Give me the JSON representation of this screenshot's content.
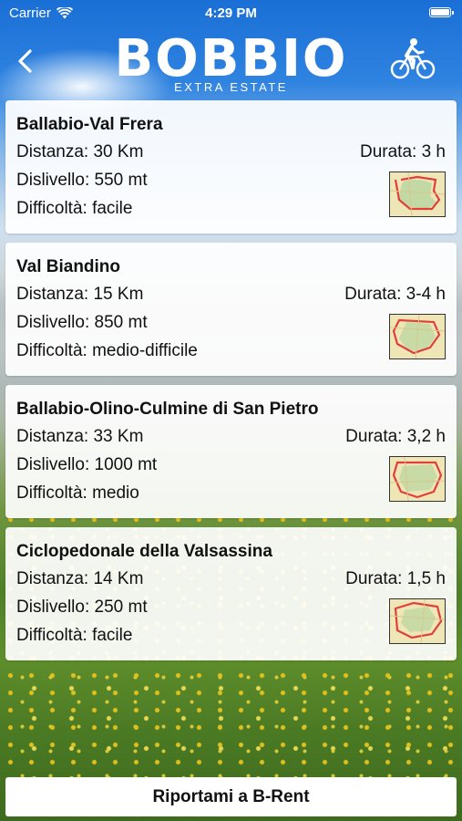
{
  "status": {
    "carrier": "Carrier",
    "time": "4:29 PM",
    "battery_level": 1.0
  },
  "header": {
    "logo_title": "BOBBIO",
    "logo_subtitle": "EXTRA ESTATE",
    "back_icon": "chevron-left-icon",
    "bike_icon": "cyclist-icon"
  },
  "routes": [
    {
      "title": "Ballabio-Val Frera",
      "distance": "Distanza: 30 Km",
      "duration": "Durata: 3 h",
      "elevation": "Dislivello: 550 mt",
      "difficulty": "Difficoltà: facile"
    },
    {
      "title": "Val Biandino",
      "distance": "Distanza: 15 Km",
      "duration": "Durata: 3-4 h",
      "elevation": "Dislivello: 850 mt",
      "difficulty": "Difficoltà: medio-difficile"
    },
    {
      "title": "Ballabio-Olino-Culmine di San Pietro",
      "distance": "Distanza: 33 Km",
      "duration": "Durata: 3,2 h",
      "elevation": "Dislivello: 1000 mt",
      "difficulty": "Difficoltà: medio"
    },
    {
      "title": "Ciclopedonale della Valsassina",
      "distance": "Distanza: 14 Km",
      "duration": "Durata: 1,5 h",
      "elevation": "Dislivello: 250 mt",
      "difficulty": "Difficoltà: facile"
    }
  ],
  "footer": {
    "button_label": "Riportami a B-Rent"
  },
  "colors": {
    "sky": "#1a6fd6",
    "card_bg": "#ffffff",
    "route_line": "#e0403a",
    "map_base": "#efe6b8"
  }
}
